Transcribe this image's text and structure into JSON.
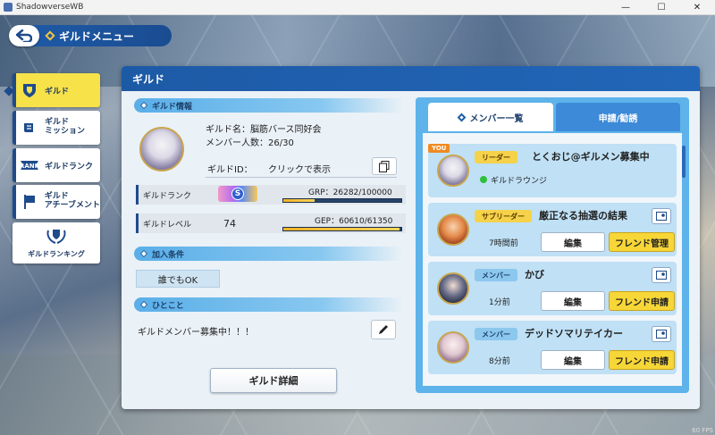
{
  "window": {
    "title": "ShadowverseWB",
    "controls": [
      "—",
      "☐",
      "✕"
    ],
    "fps": "60 FPS"
  },
  "header": {
    "title": "ギルドメニュー"
  },
  "sidebar": {
    "items": [
      {
        "label": "ギルド",
        "icon": "guild-shield-icon",
        "active": true
      },
      {
        "label": "ギルド\nミッション",
        "icon": "mission-scroll-icon",
        "active": false
      },
      {
        "label": "ギルドランク",
        "icon": "rank-banner-icon",
        "active": false
      },
      {
        "label": "ギルド\nアチーブメント",
        "icon": "achievement-flag-icon",
        "active": false
      },
      {
        "label": "ギルドランキング",
        "icon": "laurel-ranking-icon",
        "active": false
      }
    ]
  },
  "panel": {
    "title": "ギルド"
  },
  "guild_info": {
    "section_label": "ギルド情報",
    "name_label": "ギルド名：",
    "name": "脳筋バース同好会",
    "members_label": "メンバー人数：",
    "members": "26/30",
    "id_label": "ギルドID：",
    "id_value": "クリックで表示",
    "rank_label": "ギルドランク",
    "rank_badge": "S",
    "grp_text": "GRP：26282/100000",
    "grp_fraction": 0.263,
    "level_label": "ギルドレベル",
    "level": "74",
    "gep_text": "GEP：60610/61350",
    "gep_fraction": 0.988
  },
  "join": {
    "section_label": "加入条件",
    "value": "誰でもOK"
  },
  "comment": {
    "section_label": "ひとこと",
    "text": "ギルドメンバー募集中！！！"
  },
  "detail_button": "ギルド詳細",
  "tabs": {
    "members": "メンバー一覧",
    "requests": "申請/勧誘"
  },
  "members": [
    {
      "you": "YOU",
      "role": "リーダー",
      "name": "とくおじ@ギルメン募集中",
      "status": "ギルドラウンジ"
    },
    {
      "role": "サブリーダー",
      "name": "厳正なる抽選の結果",
      "ago": "7時間前",
      "edit": "編集",
      "action": "フレンド管理"
    },
    {
      "role": "メンバー",
      "name": "かび",
      "ago": "1分前",
      "edit": "編集",
      "action": "フレンド申請"
    },
    {
      "role": "メンバー",
      "name": "デッドソマリテイカー",
      "ago": "8分前",
      "edit": "編集",
      "action": "フレンド申請"
    }
  ],
  "colors": {
    "accent": "#1e5aa8",
    "highlight": "#f7d637",
    "list_bg": "#5db3ea"
  }
}
